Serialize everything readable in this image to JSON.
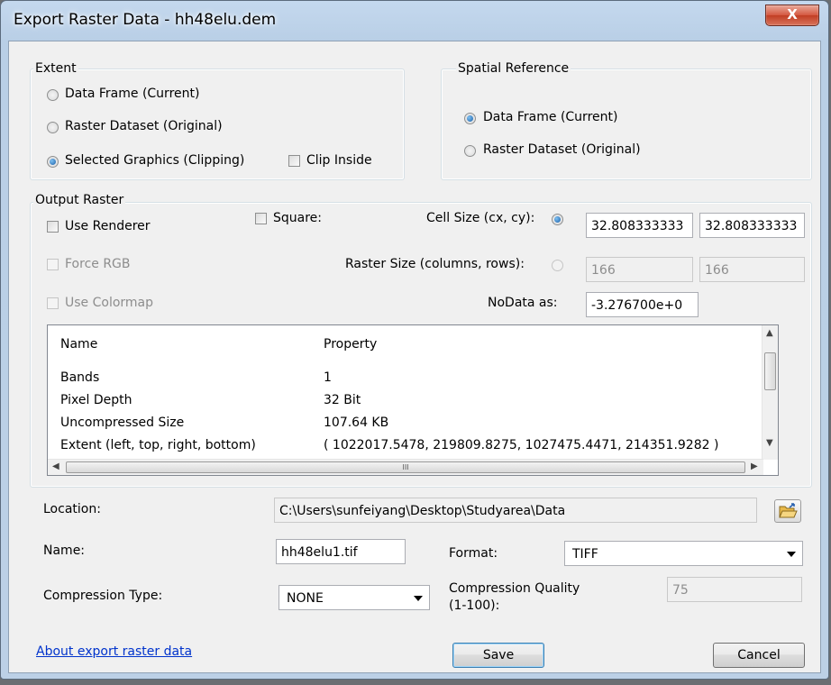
{
  "window": {
    "title": "Export Raster Data - hh48elu.dem",
    "close_glyph": "X"
  },
  "extent": {
    "title": "Extent",
    "data_frame": "Data Frame (Current)",
    "raster_dataset": "Raster Dataset (Original)",
    "selected_graphics": "Selected Graphics (Clipping)",
    "clip_inside": "Clip Inside",
    "selected": "selected_graphics"
  },
  "spatial_reference": {
    "title": "Spatial Reference",
    "data_frame": "Data Frame (Current)",
    "raster_dataset": "Raster Dataset (Original)",
    "selected": "data_frame"
  },
  "output_raster": {
    "title": "Output Raster",
    "use_renderer": "Use Renderer",
    "square": "Square:",
    "force_rgb": "Force RGB",
    "use_colormap": "Use Colormap",
    "cell_size_label": "Cell Size (cx, cy):",
    "cell_cx": "32.808333333",
    "cell_cy": "32.808333333",
    "raster_size_label": "Raster Size (columns, rows):",
    "columns": "166",
    "rows": "166",
    "nodata_label": "NoData as:",
    "nodata_value": "-3.276700e+0"
  },
  "properties": {
    "headers": [
      "Name",
      "Property"
    ],
    "rows": [
      {
        "name": "Bands",
        "value": "1"
      },
      {
        "name": "Pixel Depth",
        "value": "32 Bit"
      },
      {
        "name": "Uncompressed Size",
        "value": "107.64 KB"
      },
      {
        "name": "Extent (left, top, right, bottom)",
        "value": "( 1022017.5478, 219809.8275, 1027475.4471, 214351.9282 )"
      }
    ],
    "hscroll_grip": "III"
  },
  "location": {
    "label": "Location:",
    "value": "C:\\Users\\sunfeiyang\\Desktop\\Studyarea\\Data"
  },
  "name": {
    "label": "Name:",
    "value": "hh48elu1.tif"
  },
  "format": {
    "label": "Format:",
    "value": "TIFF"
  },
  "compression": {
    "type_label": "Compression Type:",
    "type_value": "NONE",
    "quality_label_1": "Compression Quality",
    "quality_label_2": "(1-100):",
    "quality_value": "75"
  },
  "footer": {
    "help_link": "About export raster data",
    "save": "Save",
    "cancel": "Cancel"
  },
  "icons": {
    "folder": "folder-open-icon"
  }
}
